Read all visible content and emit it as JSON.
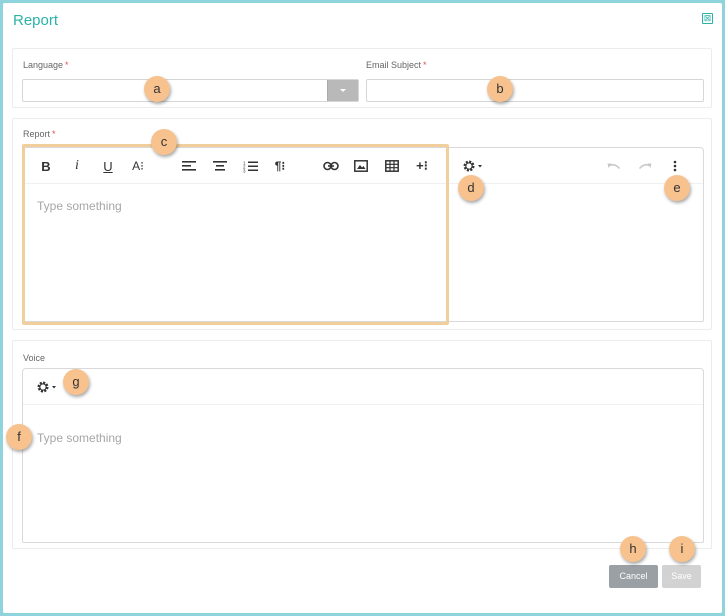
{
  "dialog": {
    "title": "Report",
    "close_glyph": "⊠"
  },
  "language": {
    "label": "Language",
    "required_mark": "*",
    "value": ""
  },
  "email_subject": {
    "label": "Email Subject",
    "required_mark": "*",
    "value": ""
  },
  "report": {
    "label": "Report",
    "required_mark": "*",
    "placeholder": "Type something",
    "toolbar": {
      "bold": "B",
      "italic": "i",
      "underline": "U",
      "font_size": "A⁝",
      "paragraph": "¶⁝",
      "insert_more": "+⁝"
    }
  },
  "voice": {
    "label": "Voice",
    "placeholder": "Type something"
  },
  "actions": {
    "cancel_label": "Cancel",
    "save_label": "Save"
  },
  "markers": [
    "a",
    "b",
    "c",
    "d",
    "e",
    "f",
    "g",
    "h",
    "i"
  ],
  "colors": {
    "title": "#2bb3a8",
    "required": "#e05050",
    "marker": "#f7c28e",
    "highlight": "#f0cf9c",
    "cancel": "#9aa0a4",
    "save": "#d2d2d2",
    "backdrop": "#8fd4dc"
  }
}
